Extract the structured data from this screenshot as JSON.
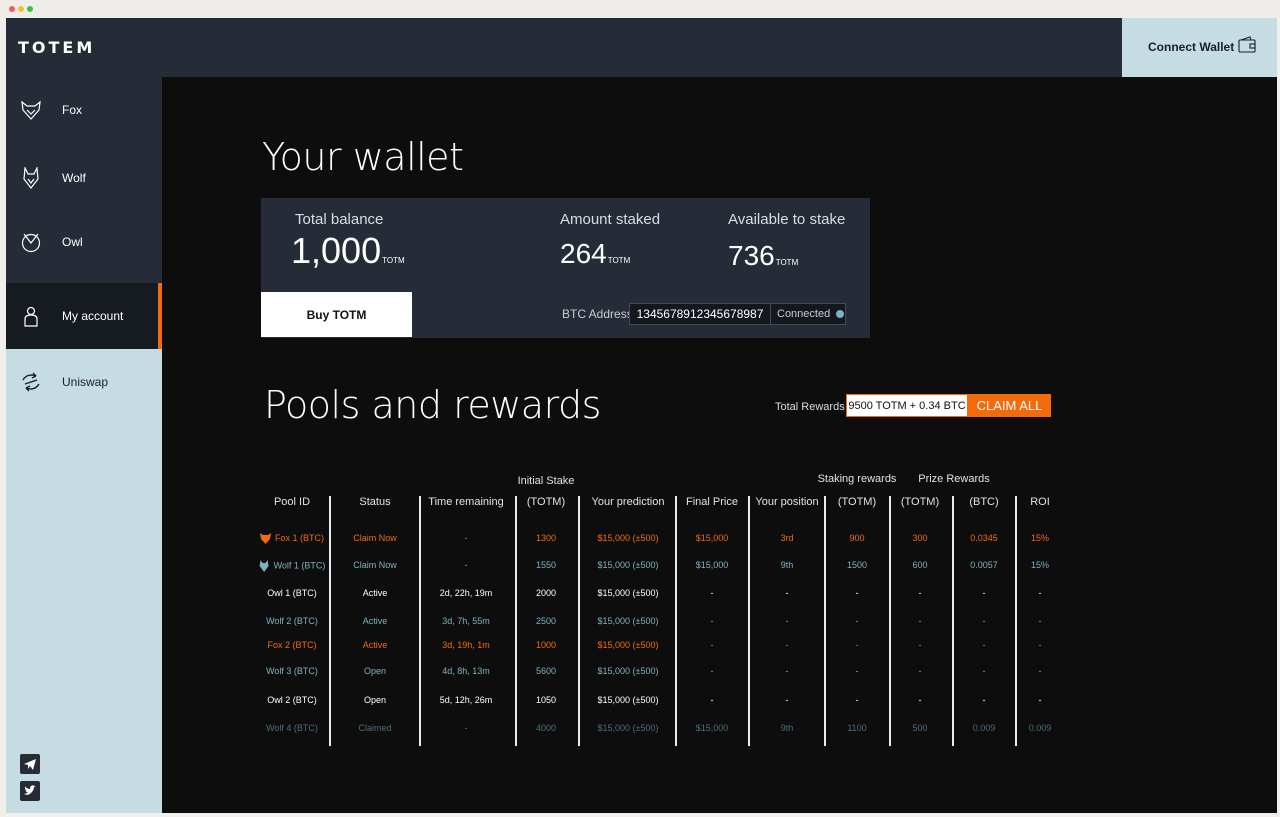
{
  "brand": {
    "logo": "TOTEM",
    "accent": "#f26c0d"
  },
  "header": {
    "connect_label": "Connect Wallet",
    "connect_icon": "wallet-icon"
  },
  "sidebar": {
    "items": [
      {
        "label": "Fox",
        "icon": "fox-icon"
      },
      {
        "label": "Wolf",
        "icon": "wolf-icon"
      },
      {
        "label": "Owl",
        "icon": "owl-icon"
      },
      {
        "label": "My account",
        "icon": "user-icon",
        "active": true
      },
      {
        "label": "Uniswap",
        "icon": "uniswap-icon"
      }
    ],
    "social": [
      "telegram-icon",
      "twitter-icon"
    ]
  },
  "wallet": {
    "title": "Your wallet",
    "total_balance_label": "Total balance",
    "total_balance_value": "1,000",
    "total_balance_unit": "TOTM",
    "amount_staked_label": "Amount staked",
    "amount_staked_value": "264",
    "amount_staked_unit": "TOTM",
    "available_label": "Available to stake",
    "available_value": "736",
    "available_unit": "TOTM",
    "buy_label": "Buy TOTM",
    "btc_address_label": "BTC Address",
    "btc_address_value": "1345678912345678987",
    "connection_status": "Connected"
  },
  "pools": {
    "title": "Pools and rewards",
    "total_rewards_label": "Total Rewards",
    "total_rewards_value": "9500 TOTM + 0.34 BTC",
    "claim_all_label": "CLAIM ALL",
    "group_headers": {
      "initial_stake": "Initial Stake",
      "staking_rewards": "Staking rewards",
      "prize_rewards": "Prize Rewards"
    },
    "columns": [
      "Pool ID",
      "Status",
      "Time remaining",
      "(TOTM)",
      "Your prediction",
      "Final Price",
      "Your position",
      "(TOTM)",
      "(TOTM)",
      "(BTC)",
      "ROI"
    ],
    "rows": [
      {
        "style": "orange",
        "icon": "fox-icon",
        "cells": [
          "Fox 1 (BTC)",
          "Claim Now",
          "-",
          "1300",
          "$15,000 (±500)",
          "$15,000",
          "3rd",
          "900",
          "300",
          "0.0345",
          "15%"
        ]
      },
      {
        "style": "teal",
        "icon": "wolf-icon",
        "cells": [
          "Wolf 1 (BTC)",
          "Claim Now",
          "-",
          "1550",
          "$15,000 (±500)",
          "$15,000",
          "9th",
          "1500",
          "600",
          "0.0057",
          "15%"
        ]
      },
      {
        "style": "white",
        "icon": "",
        "cells": [
          "Owl 1 (BTC)",
          "Active",
          "2d, 22h, 19m",
          "2000",
          "$15,000 (±500)",
          "-",
          "-",
          "-",
          "-",
          "-",
          "-"
        ]
      },
      {
        "style": "teal",
        "icon": "",
        "cells": [
          "Wolf 2 (BTC)",
          "Active",
          "3d, 7h, 55m",
          "2500",
          "$15,000 (±500)",
          "-",
          "-",
          "-",
          "-",
          "-",
          "-"
        ]
      },
      {
        "style": "orange",
        "icon": "",
        "cells": [
          "Fox 2 (BTC)",
          "Active",
          "3d, 19h, 1m",
          "1000",
          "$15,000 (±500)",
          "-",
          "-",
          "-",
          "-",
          "-",
          "-"
        ]
      },
      {
        "style": "teal",
        "icon": "",
        "cells": [
          "Wolf 3 (BTC)",
          "Open",
          "4d, 8h, 13m",
          "5600",
          "$15,000 (±500)",
          "-",
          "-",
          "-",
          "-",
          "-",
          "-"
        ]
      },
      {
        "style": "white",
        "icon": "",
        "cells": [
          "Owl 2 (BTC)",
          "Open",
          "5d, 12h, 26m",
          "1050",
          "$15,000 (±500)",
          "-",
          "-",
          "-",
          "-",
          "-",
          "-"
        ]
      },
      {
        "style": "dim",
        "icon": "",
        "cells": [
          "Wolf 4 (BTC)",
          "Claimed",
          "-",
          "4000",
          "$15,000 (±500)",
          "$15,000",
          "9th",
          "1100",
          "500",
          "0.009",
          "0.009"
        ]
      }
    ]
  }
}
